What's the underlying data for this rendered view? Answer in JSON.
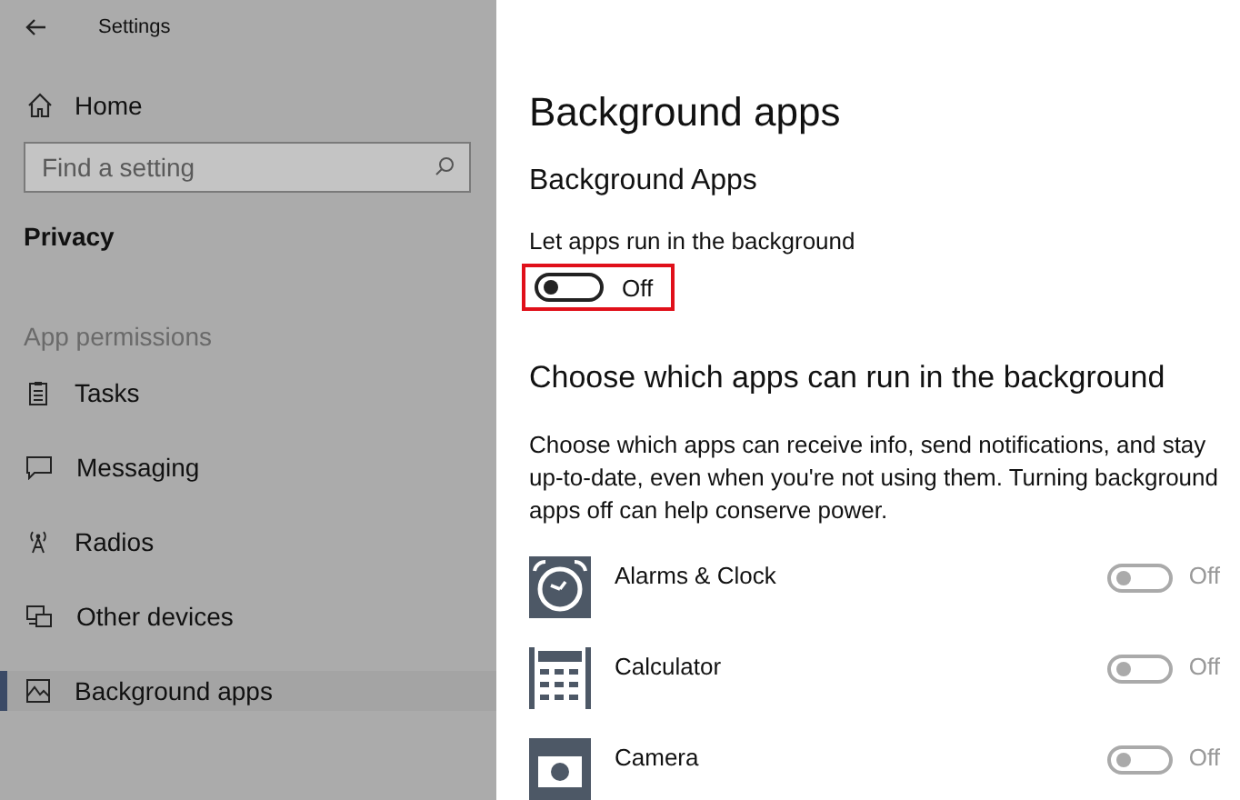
{
  "window": {
    "title": "Settings"
  },
  "sidebar": {
    "home": "Home",
    "search": {
      "placeholder": "Find a setting"
    },
    "section": "Privacy",
    "group": "App permissions",
    "items": [
      {
        "label": "Tasks",
        "selected": false
      },
      {
        "label": "Messaging",
        "selected": false
      },
      {
        "label": "Radios",
        "selected": false
      },
      {
        "label": "Other devices",
        "selected": false
      },
      {
        "label": "Background apps",
        "selected": true
      }
    ]
  },
  "page": {
    "title": "Background apps",
    "subtitle": "Background Apps",
    "master": {
      "label": "Let apps run in the background",
      "on": false,
      "state": "Off",
      "highlighted": true
    },
    "heading": "Choose which apps can run in the background",
    "description": "Choose which apps can receive info, send notifications, and stay up-to-date, even when you're not using them. Turning background apps off can help conserve power.",
    "apps": [
      {
        "name": "Alarms & Clock",
        "on": false,
        "disabled": true,
        "state": "Off"
      },
      {
        "name": "Calculator",
        "on": false,
        "disabled": true,
        "state": "Off"
      },
      {
        "name": "Camera",
        "on": false,
        "disabled": true,
        "state": "Off"
      }
    ]
  }
}
